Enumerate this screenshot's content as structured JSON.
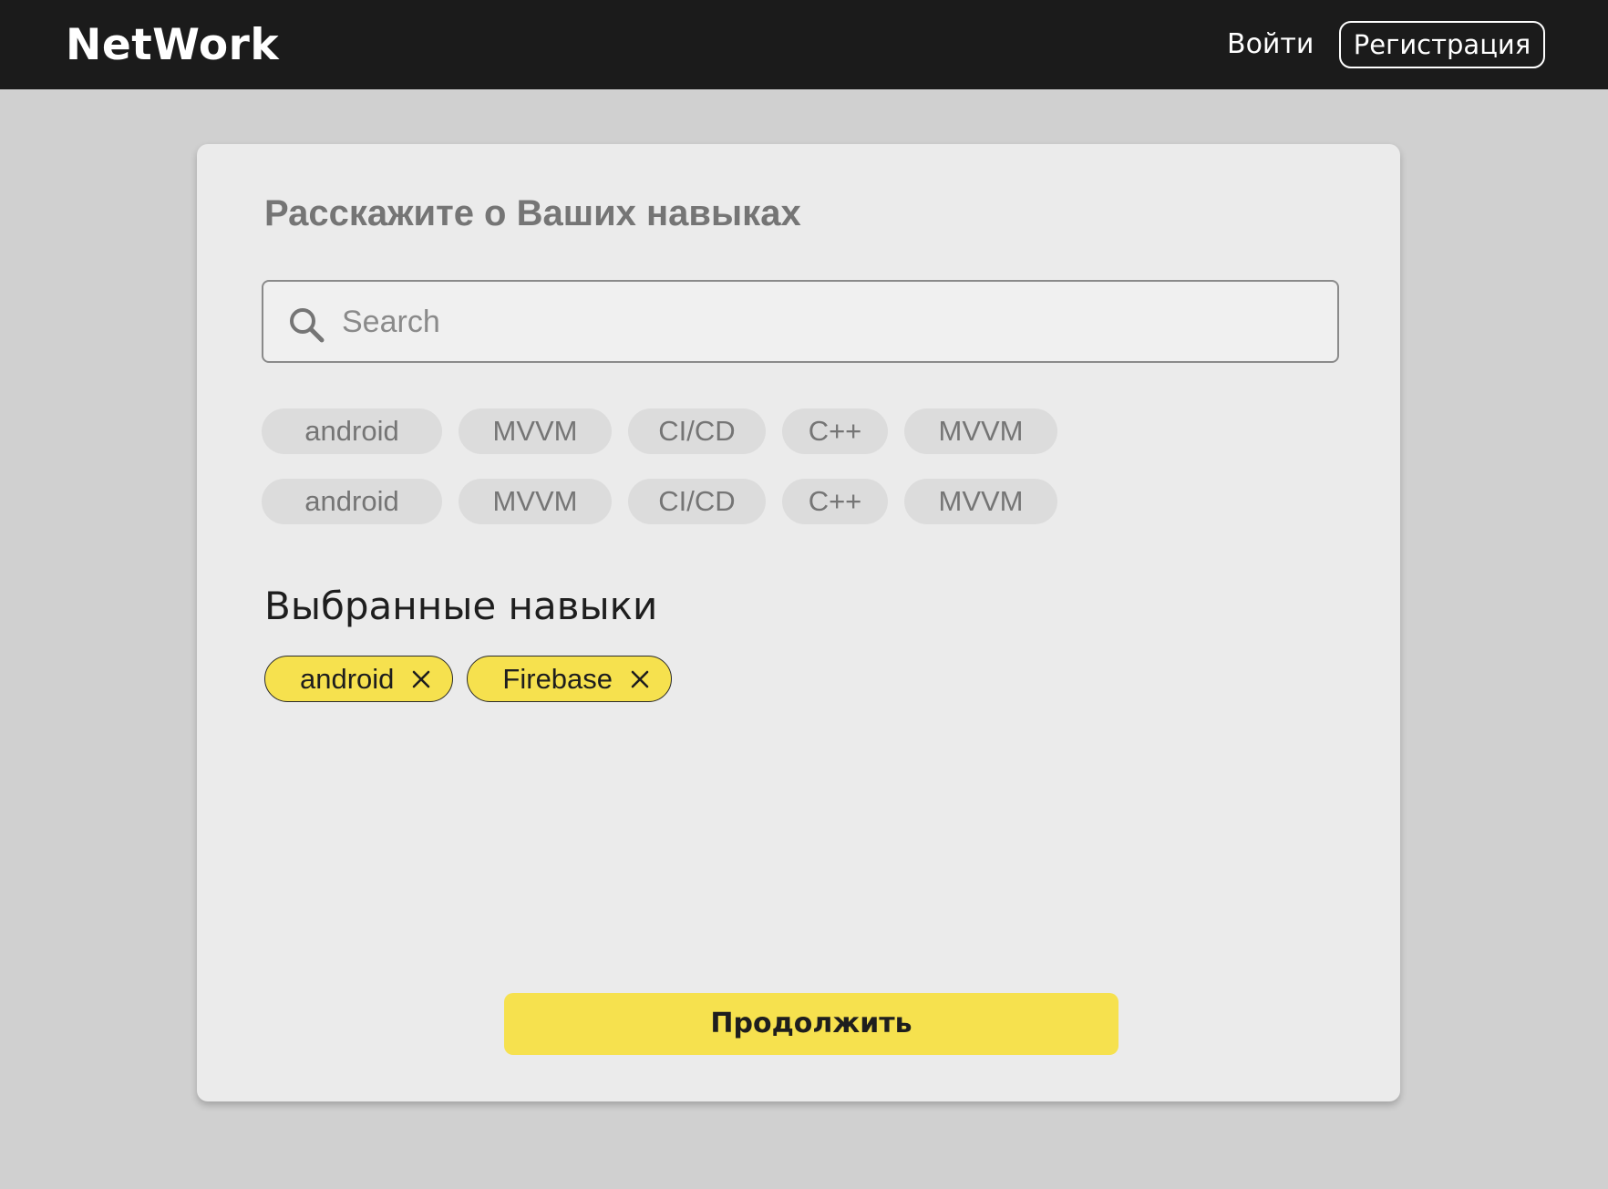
{
  "header": {
    "logo": "NetWork",
    "login_label": "Войти",
    "register_label": "Регистрация"
  },
  "skills_card": {
    "title": "Расскажите о Ваших навыках",
    "search": {
      "placeholder": "Search",
      "value": "",
      "icon": "search-icon"
    },
    "suggestions": [
      [
        "android",
        "MVVM",
        "CI/CD",
        "C++",
        "MVVM"
      ],
      [
        "android",
        "MVVM",
        "CI/CD",
        "C++",
        "MVVM"
      ]
    ],
    "selected_title": "Выбранные навыки",
    "selected": [
      {
        "label": "android",
        "remove_icon": "close-icon"
      },
      {
        "label": "Firebase",
        "remove_icon": "close-icon"
      }
    ],
    "continue_label": "Продолжить"
  },
  "colors": {
    "topbar": "#1b1b1b",
    "background": "#d0d0d0",
    "card": "#ebebeb",
    "accent_yellow": "#f6e14e",
    "chip_gray": "#dcdcdc"
  }
}
